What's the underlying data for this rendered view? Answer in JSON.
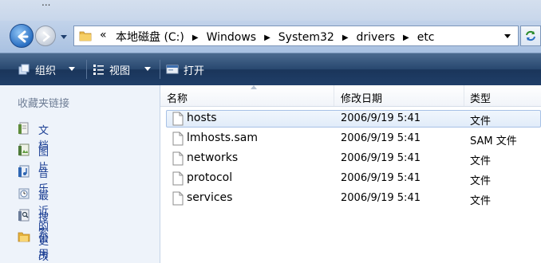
{
  "window": {
    "title_fragment": "..."
  },
  "address": {
    "overflow_marker": "«",
    "crumbs": [
      "本地磁盘 (C:)",
      "Windows",
      "System32",
      "drivers",
      "etc"
    ]
  },
  "toolbar": {
    "organize_label": "组织",
    "views_label": "视图",
    "open_label": "打开"
  },
  "sidebar": {
    "title": "收藏夹链接",
    "items": [
      {
        "label": "文档",
        "icon": "documents-icon"
      },
      {
        "label": "图片",
        "icon": "pictures-icon"
      },
      {
        "label": "音乐",
        "icon": "music-icon"
      },
      {
        "label": "最近的更改",
        "icon": "recent-changes-icon"
      },
      {
        "label": "搜索",
        "icon": "search-icon"
      },
      {
        "label": "公用",
        "icon": "public-folder-icon"
      }
    ]
  },
  "columns": {
    "name": "名称",
    "date": "修改日期",
    "type": "类型"
  },
  "files": [
    {
      "name": "hosts",
      "date": "2006/9/19 5:41",
      "type": "文件"
    },
    {
      "name": "lmhosts.sam",
      "date": "2006/9/19 5:41",
      "type": "SAM 文件"
    },
    {
      "name": "networks",
      "date": "2006/9/19 5:41",
      "type": "文件"
    },
    {
      "name": "protocol",
      "date": "2006/9/19 5:41",
      "type": "文件"
    },
    {
      "name": "services",
      "date": "2006/9/19 5:41",
      "type": "文件"
    }
  ],
  "colors": {
    "toolbar": "#203f69",
    "sidebar_bg": "#eef3fa",
    "link": "#1c3f94",
    "selection_border": "#a7c1e6"
  }
}
